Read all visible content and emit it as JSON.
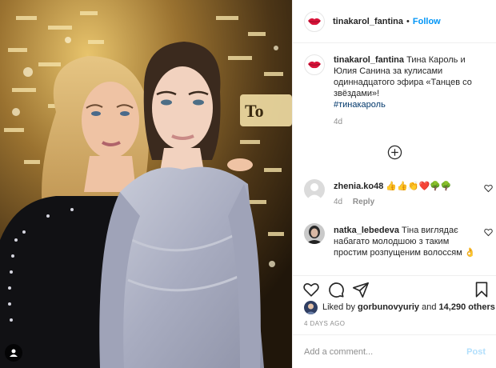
{
  "post": {
    "author": "tinakarol_fantina",
    "follow_label": "Follow",
    "dot": "•",
    "photo_sign_text": "To"
  },
  "caption": {
    "username": "tinakarol_fantina",
    "text": "Тина Кароль и Юлия Санина за кулисами одиннадцатого эфира «Танцев со звёздами»!",
    "hashtag": "#тинакароль",
    "time": "4d"
  },
  "comments": [
    {
      "username": "zhenia.ko48",
      "text": "👍👍👏❤️🌳🌳",
      "time": "4d",
      "reply_label": "Reply"
    },
    {
      "username": "natka_lebedeva",
      "text": "Тіна виглядає набагато молодшою з таким простим розпущеним волоссям 👌",
      "time": "",
      "reply_label": ""
    }
  ],
  "likes": {
    "prefix": "Liked by",
    "user": "gorbunovyuriy",
    "connector": "and",
    "count": "14,290 others"
  },
  "date_label": "4 DAYS AGO",
  "add_comment": {
    "placeholder": "Add a comment...",
    "post_label": "Post"
  },
  "icons": {
    "profile": "lips-icon",
    "load_more": "plus-circle-icon",
    "like": "heart-icon",
    "comment": "comment-icon",
    "share": "paper-plane-icon",
    "save": "bookmark-icon",
    "tagged_users": "user-tag-icon"
  },
  "colors": {
    "accent": "#0095f6",
    "hashtag": "#00376b",
    "muted": "#8e8e8e",
    "post_disabled": "#b2dffc",
    "lips": "#d8143a"
  }
}
